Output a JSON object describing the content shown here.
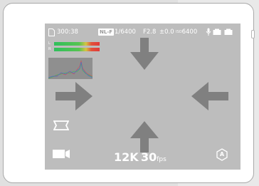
{
  "status_bar": {
    "remaining": "300:38",
    "profile_badge": "NL-F",
    "shutter": "1/6400",
    "aperture": "F2.8",
    "exposure_comp": "±0.0",
    "iso_prefix": "ISO",
    "iso_value": "6400"
  },
  "audio_meter": {
    "left_label": "L",
    "right_label": "R",
    "left_level": 0.95,
    "right_level": 0.95
  },
  "bottom": {
    "resolution": "12K",
    "frame_rate_value": "30",
    "frame_rate_unit": "fps",
    "mode_badge": "A"
  },
  "icons": {
    "storage": "memory-card-icon",
    "mic": "microphone-icon",
    "battery_1": "battery-icon",
    "battery_2": "battery-icon",
    "aspect": "aspect-ratio-icon",
    "video_mode": "video-camera-icon",
    "auto_mode": "auto-mode-icon",
    "arrow_up": "arrow-up-icon",
    "arrow_down": "arrow-down-icon",
    "arrow_left": "arrow-left-icon",
    "arrow_right": "arrow-right-icon"
  },
  "colors": {
    "screen_bg": "#bdbdbd",
    "arrow": "#808080",
    "meter_green": "#2fbf5c",
    "meter_red": "#e03a3a"
  }
}
